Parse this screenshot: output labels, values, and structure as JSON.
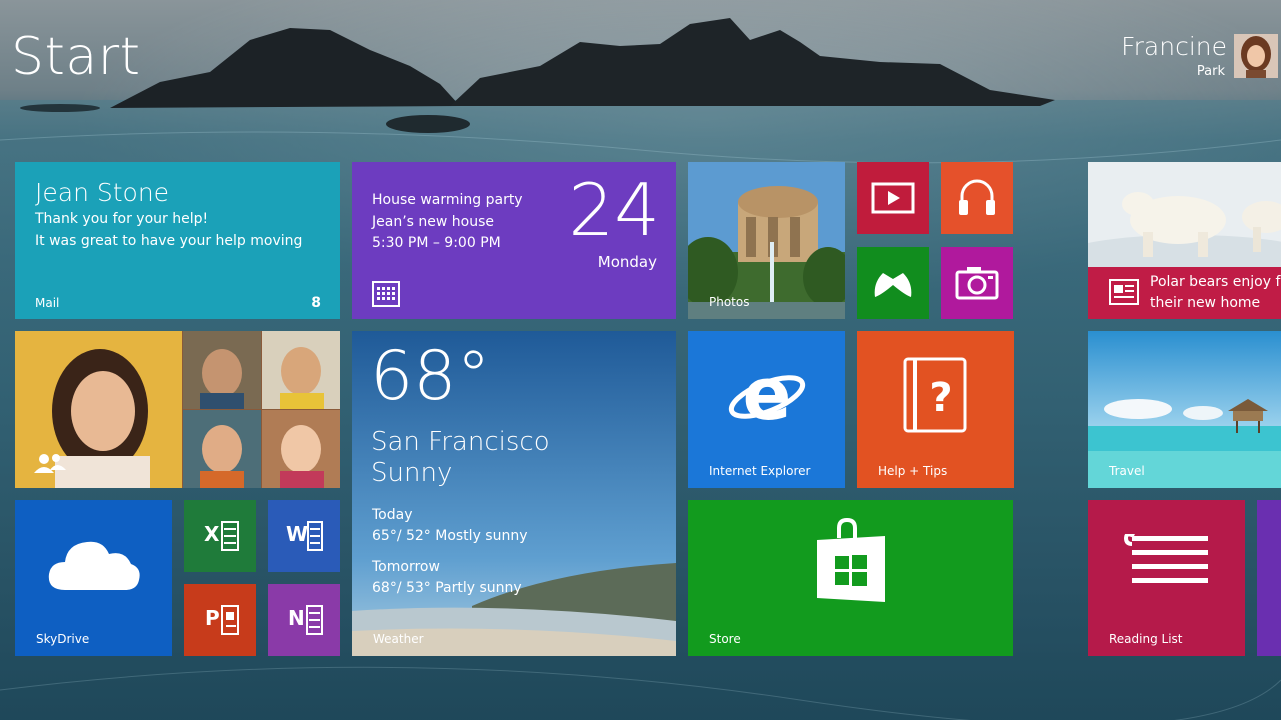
{
  "header": {
    "title": "Start",
    "user_first_name": "Francine",
    "user_last_name": "Park"
  },
  "tiles": {
    "mail": {
      "sender": "Jean Stone",
      "line1": "Thank you for your help!",
      "line2": "It was great to have your help moving",
      "label": "Mail",
      "count": "8"
    },
    "calendar": {
      "event_title": "House warming party",
      "event_location": "Jean’s new house",
      "event_time": "5:30 PM – 9:00 PM",
      "day_number": "24",
      "day_name": "Monday"
    },
    "photos": {
      "label": "Photos"
    },
    "news": {
      "headline_line1": "Polar bears enjoy fu",
      "headline_line2": "their new home"
    },
    "weather": {
      "temperature": "68°",
      "city": "San Francisco",
      "condition": "Sunny",
      "today_label": "Today",
      "today_forecast": "65°/ 52° Mostly sunny",
      "tomorrow_label": "Tomorrow",
      "tomorrow_forecast": "68°/ 53° Partly sunny",
      "label": "Weather"
    },
    "internet_explorer": {
      "label": "Internet Explorer"
    },
    "help": {
      "label": "Help + Tips"
    },
    "travel": {
      "label": "Travel"
    },
    "skydrive": {
      "label": "SkyDrive"
    },
    "excel": {
      "letter": "X"
    },
    "word": {
      "letter": "W"
    },
    "powerpoint": {
      "letter": "P"
    },
    "onenote": {
      "letter": "N"
    },
    "store": {
      "label": "Store"
    },
    "reading_list": {
      "label": "Reading List"
    }
  },
  "icons": {
    "video": "video-icon",
    "music": "headphones-icon",
    "games": "xbox-controller-icon",
    "camera": "camera-icon",
    "calendar": "calendar-grid-icon",
    "news": "newspaper-icon",
    "people": "people-icon",
    "ie": "internet-explorer-icon",
    "help": "help-book-icon",
    "skydrive": "cloud-icon",
    "store": "store-bag-icon",
    "reading": "reading-list-icon"
  },
  "colors": {
    "mail": "#1ba1b8",
    "calendar": "#6d3cc0",
    "video": "#c01c3c",
    "music": "#e5512b",
    "games": "#118d1e",
    "camera": "#b0199d",
    "news": "#c01c46",
    "ie": "#1b77d8",
    "help": "#e25222",
    "skydrive": "#0e5fc2",
    "store": "#129b1e",
    "reading": "#b51a4a"
  }
}
